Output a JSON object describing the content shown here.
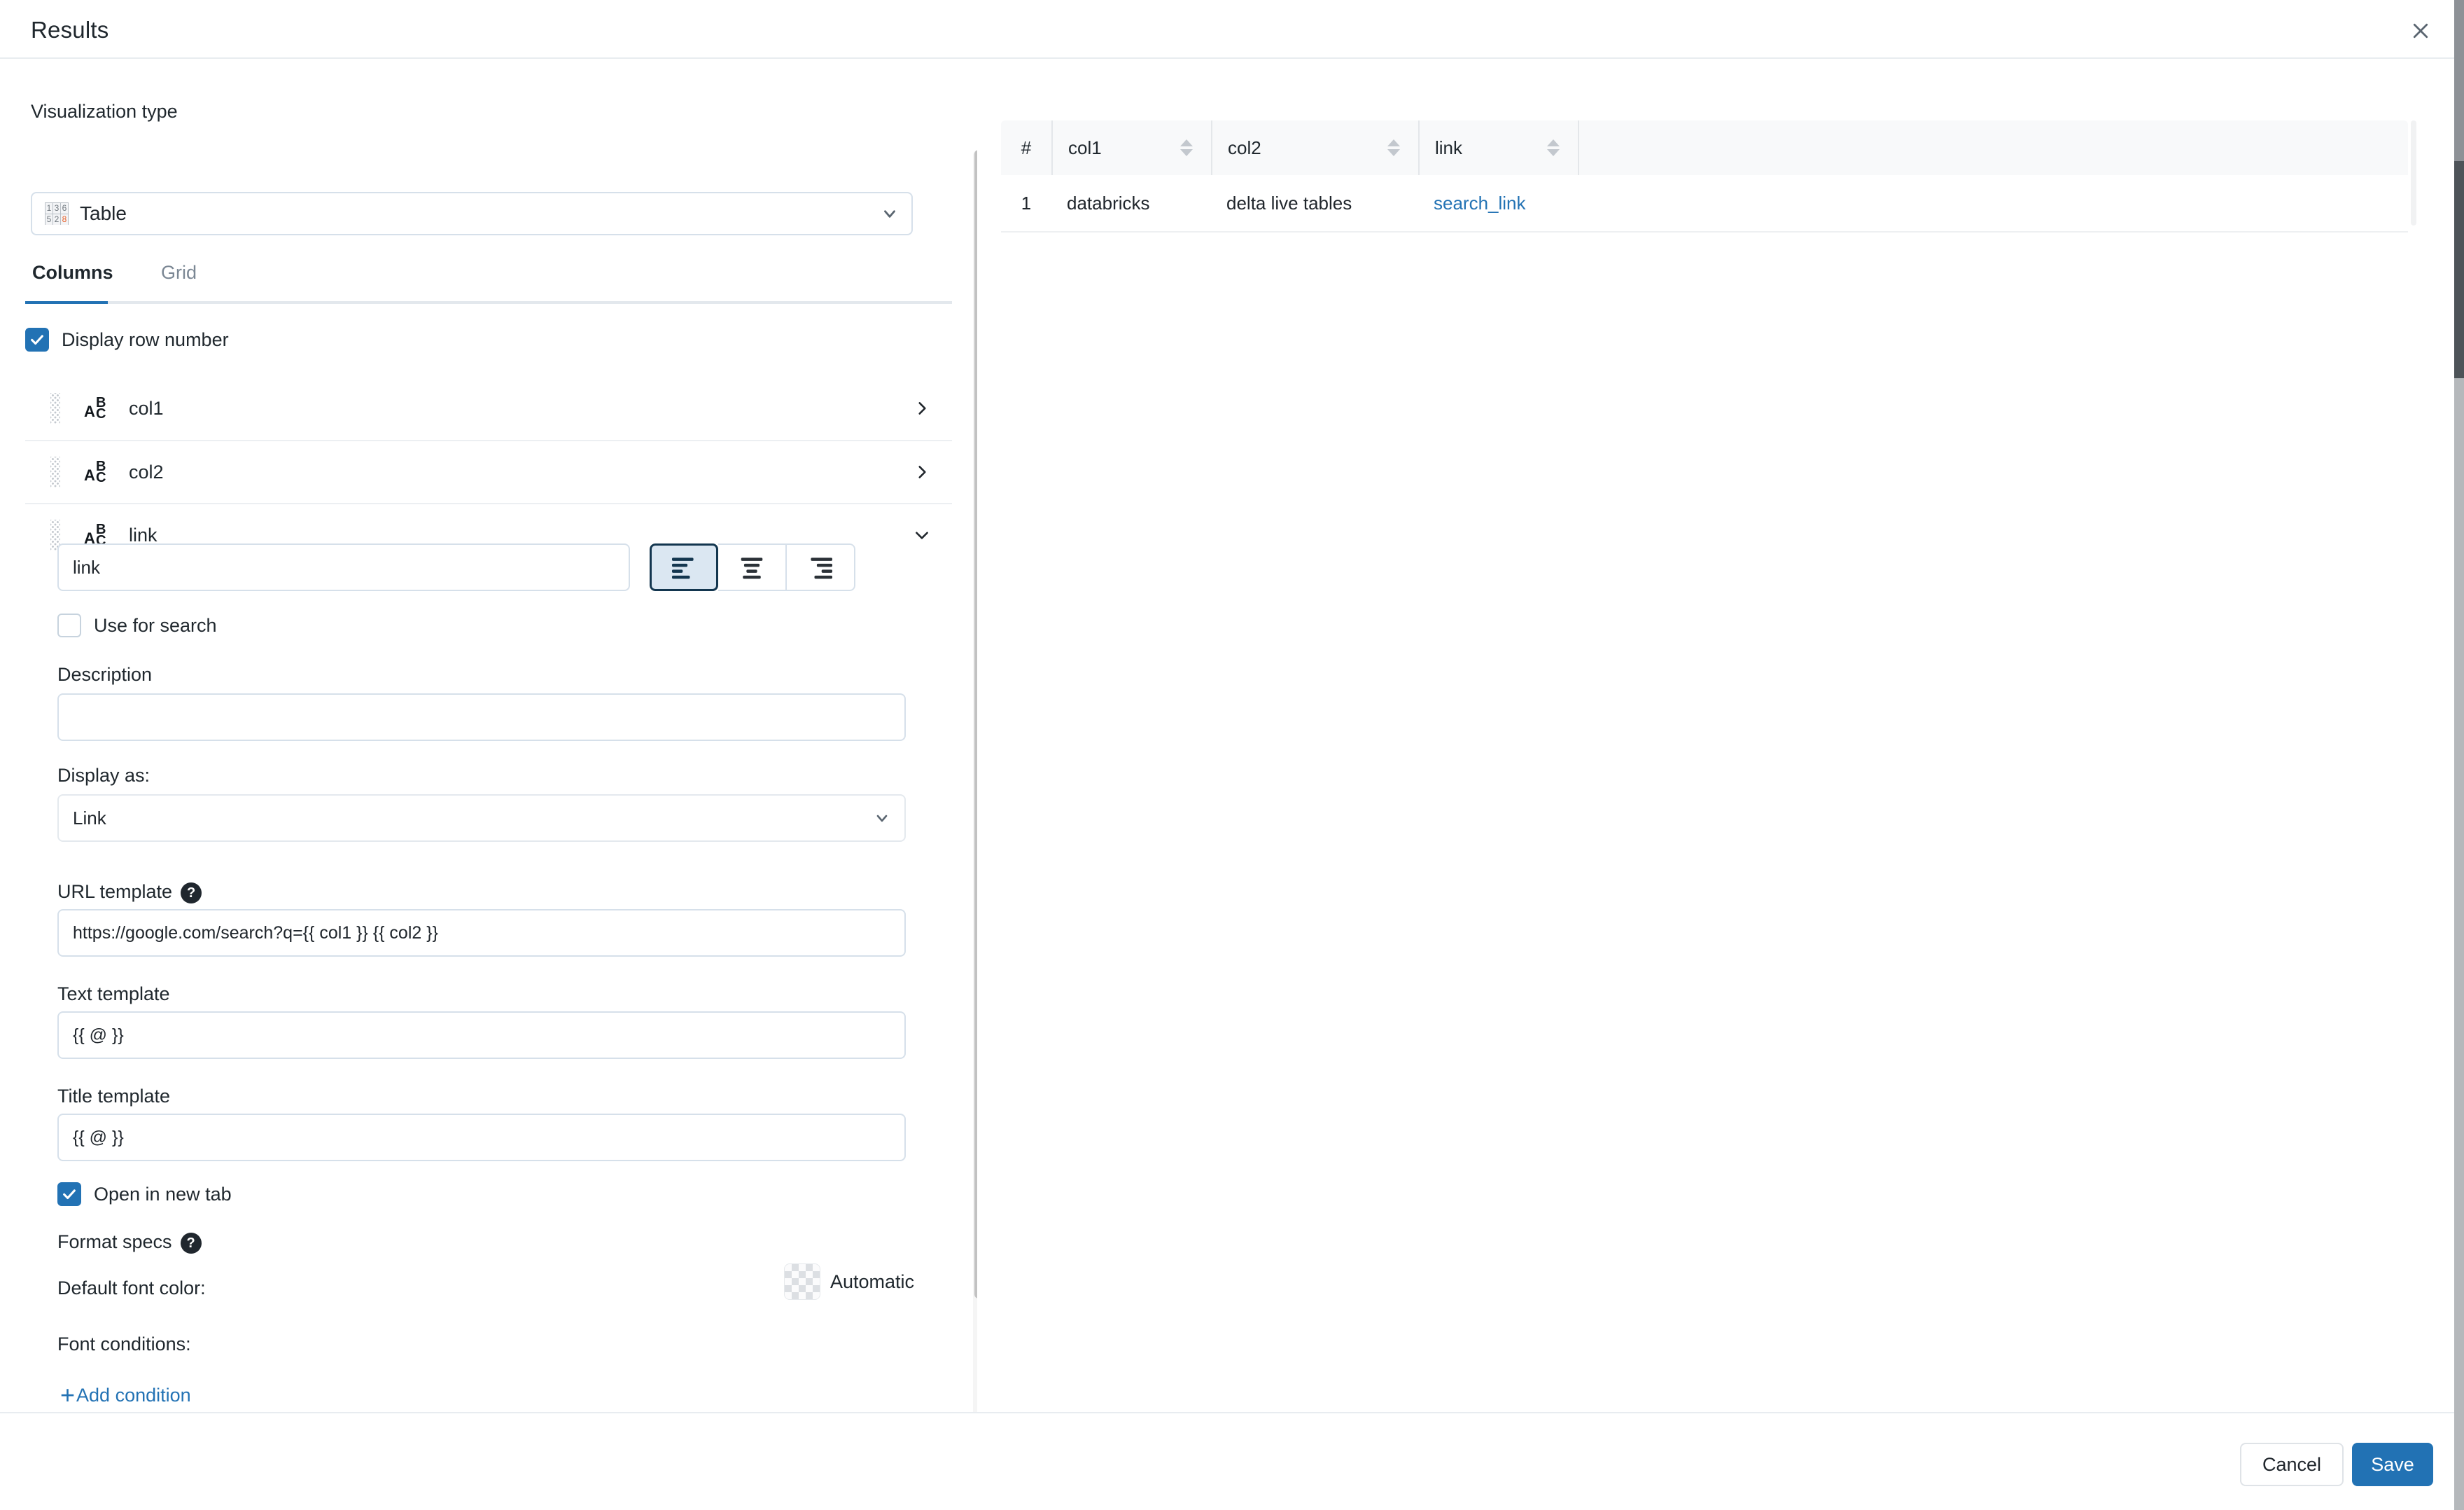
{
  "header": {
    "title": "Results",
    "close_icon": "close-icon"
  },
  "left_panel": {
    "visualization_type_label": "Visualization type",
    "visualization_type_value": "Table",
    "visualization_type_icon": "table-grid-icon",
    "table_icon_cells": [
      "1",
      "3",
      "6",
      "5",
      "2",
      "8"
    ],
    "tabs": [
      {
        "label": "Columns",
        "active": true
      },
      {
        "label": "Grid",
        "active": false
      }
    ],
    "display_row_number": {
      "label": "Display row number",
      "checked": true
    },
    "columns": [
      {
        "name": "col1",
        "type_icon": "text-type-icon",
        "expanded": false,
        "chevron": "chevron-right-icon"
      },
      {
        "name": "col2",
        "type_icon": "text-type-icon",
        "expanded": false,
        "chevron": "chevron-right-icon"
      },
      {
        "name": "link",
        "type_icon": "text-type-icon",
        "expanded": true,
        "chevron": "chevron-down-icon"
      }
    ],
    "editor": {
      "name_value": "link",
      "alignment": {
        "options": [
          "left",
          "center",
          "right"
        ],
        "selected": "left"
      },
      "use_for_search": {
        "label": "Use for search",
        "checked": false
      },
      "description_label": "Description",
      "description_value": "",
      "display_as_label": "Display as:",
      "display_as_value": "Link",
      "url_template_label": "URL template",
      "url_template_value": "https://google.com/search?q={{ col1 }} {{ col2 }}",
      "text_template_label": "Text template",
      "text_template_value": "{{ @ }}",
      "title_template_label": "Title template",
      "title_template_value": "{{ @ }}",
      "open_in_new_tab": {
        "label": "Open in new tab",
        "checked": true
      },
      "format_specs_label": "Format specs",
      "default_font_color_label": "Default font color:",
      "default_font_color_value": "Automatic",
      "font_conditions_label": "Font conditions:",
      "add_condition_label": "Add condition",
      "help_icon": "help-circle-icon"
    }
  },
  "results_table": {
    "columns": [
      "#",
      "col1",
      "col2",
      "link"
    ],
    "rows": [
      {
        "index": "1",
        "col1": "databricks",
        "col2": "delta live tables",
        "link": "search_link"
      }
    ]
  },
  "footer": {
    "cancel_label": "Cancel",
    "save_label": "Save"
  },
  "colors": {
    "accent": "#2272b4",
    "link": "#2272b4",
    "text": "#1f272d",
    "border": "#d6e0ea"
  }
}
